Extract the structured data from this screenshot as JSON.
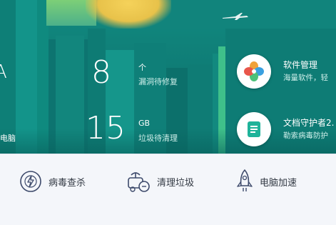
{
  "stats": {
    "vulns": {
      "value": "8",
      "unit": "个",
      "label": "漏洞待修复"
    },
    "junk": {
      "value": "15",
      "unit": "GB",
      "label": "垃圾待清理"
    }
  },
  "left_partial": {
    "glyph": "A",
    "label": "电脑"
  },
  "tools": [
    {
      "title": "软件管理",
      "subtitle": "海量软件，轻",
      "icon": "software-manager-icon"
    },
    {
      "title": "文档守护者2.",
      "subtitle": "勒索病毒防护",
      "icon": "document-guard-icon"
    }
  ],
  "actions": [
    {
      "label": "病毒查杀",
      "icon": "virus-scan-icon"
    },
    {
      "label": "清理垃圾",
      "icon": "cleanup-icon"
    },
    {
      "label": "电脑加速",
      "icon": "rocket-icon"
    }
  ],
  "colors": {
    "header_teal": "#0f7e77",
    "bottom_bg": "#f4f6fa",
    "action_icon": "#3d4a6b"
  }
}
